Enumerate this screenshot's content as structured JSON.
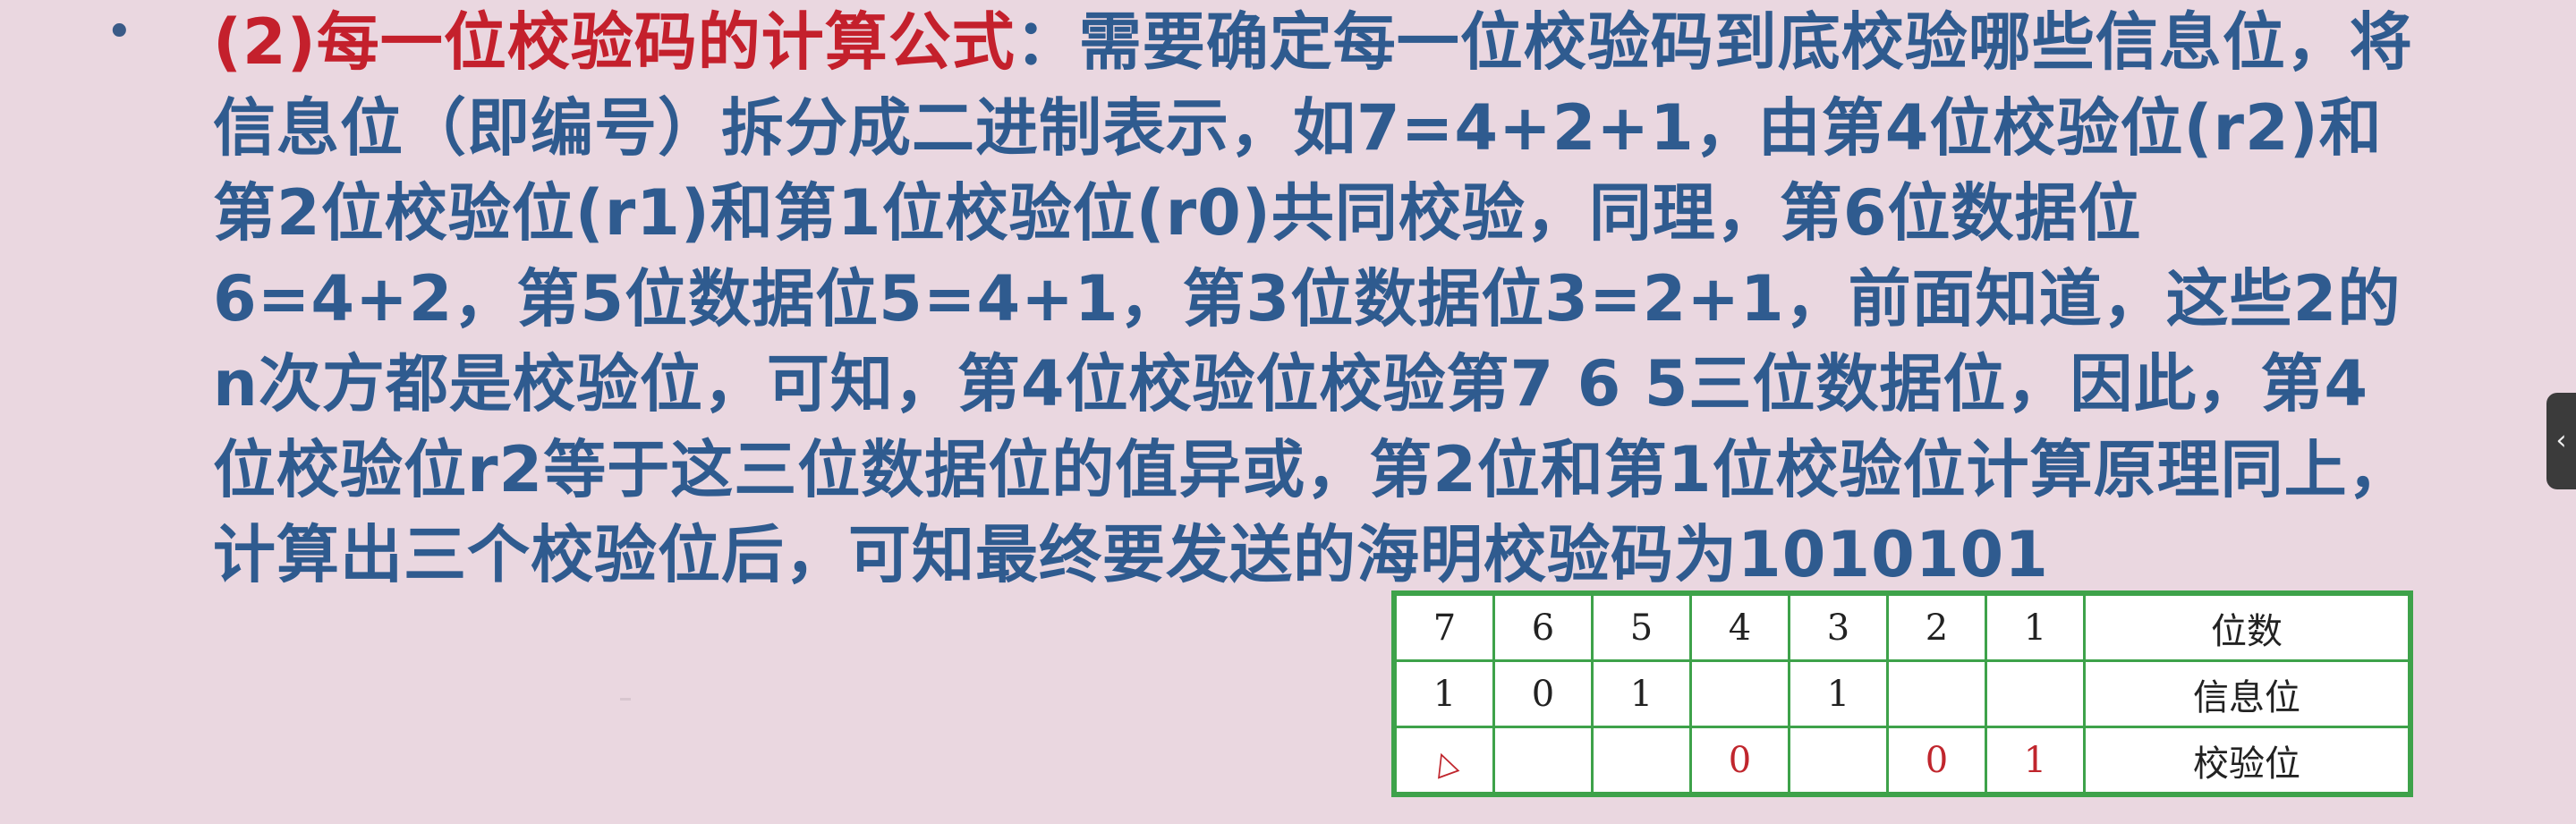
{
  "bullet": "•",
  "paragraph": {
    "prefix": "(2)",
    "heading": "每一位校验码的计算公式",
    "body": "：需要确定每一位校验码到底校验哪些信息位，将信息位（即编号）拆分成二进制表示，如7=4+2+1，由第4位校验位(r2)和第2位校验位(r1)和第1位校验位(r0)共同校验，同理，第6位数据位6=4+2，第5位数据位5=4+1，第3位数据位3=2+1，前面知道，这些2的n次方都是校验位，可知，第4位校验位校验第7 6 5三位数据位，因此，第4位校验位r2等于这三位数据位的值异或，第2位和第1位校验位计算原理同上，计算出三个校验位后，可知最终要发送的海明校验码为1010101"
  },
  "table": {
    "header": [
      "7",
      "6",
      "5",
      "4",
      "3",
      "2",
      "1",
      "位数"
    ],
    "info_row": [
      "1",
      "0",
      "1",
      "",
      "1",
      "",
      "",
      "信息位"
    ],
    "check_row": [
      "",
      "",
      "",
      "0",
      "",
      "0",
      "1",
      "校验位"
    ],
    "marker": "△",
    "check_color": "#c0262d",
    "border_color": "#3ea24a"
  },
  "side_tab": {
    "icon": "chevron-left-icon",
    "glyph": "‹"
  }
}
